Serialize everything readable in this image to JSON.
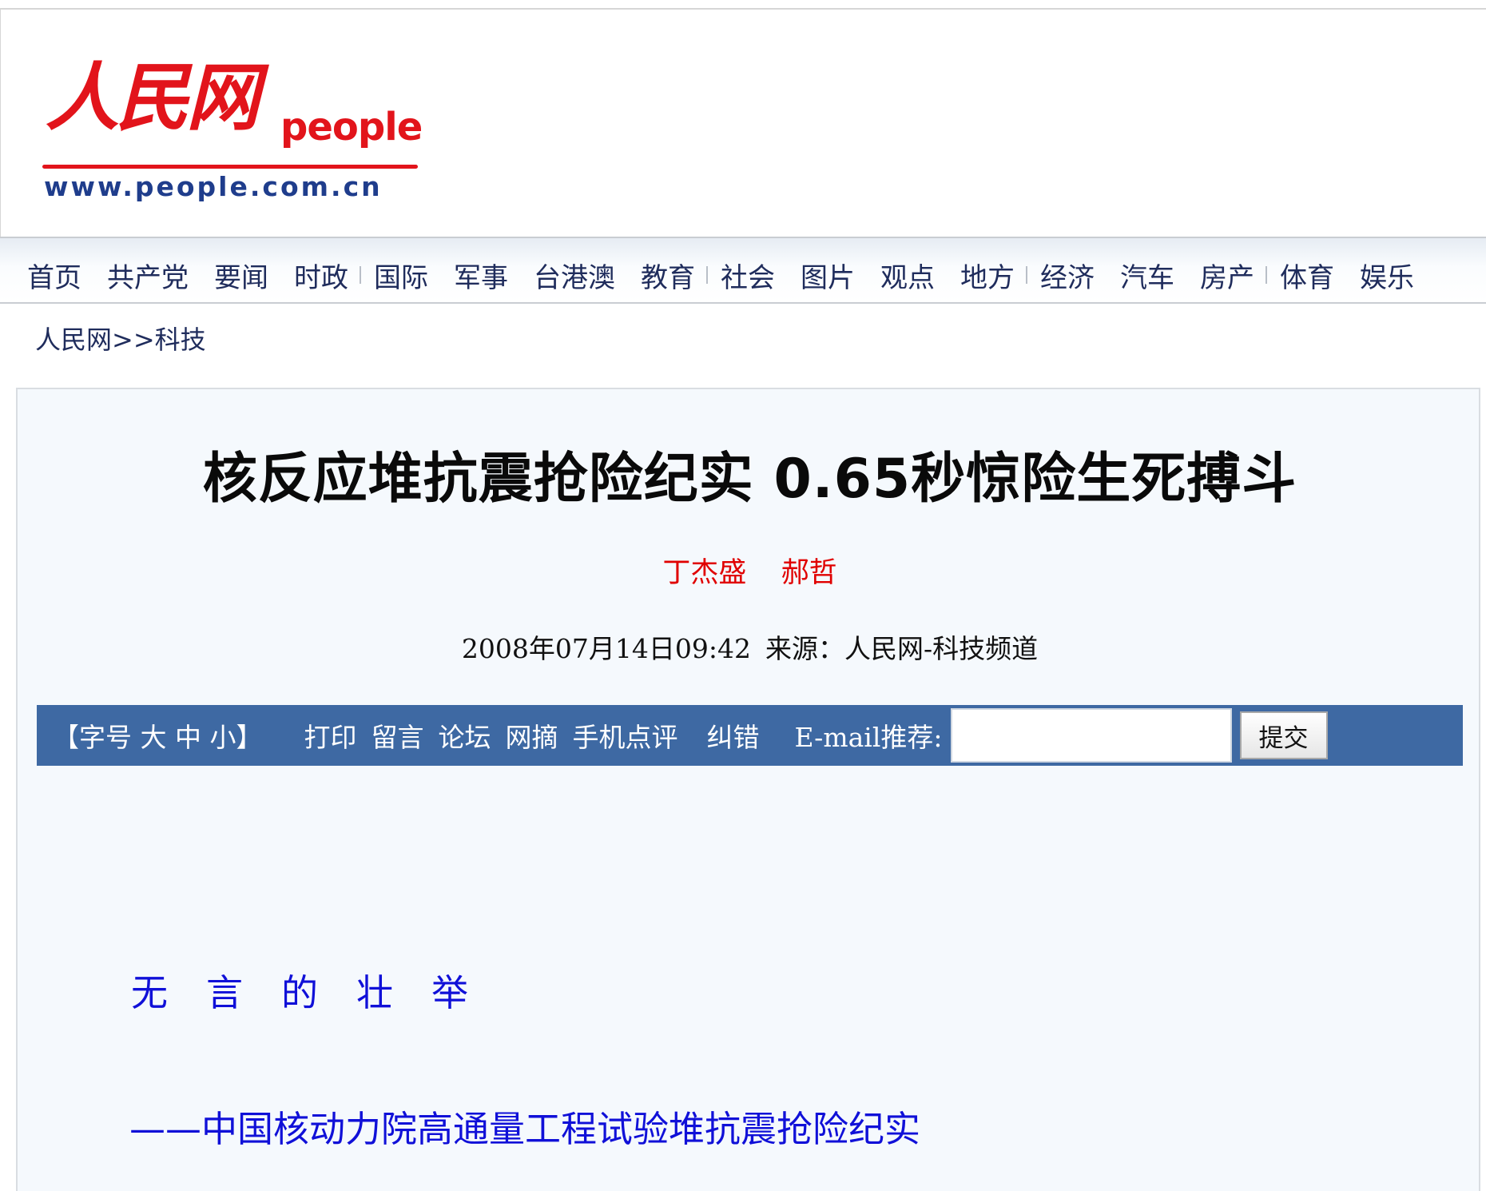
{
  "header": {
    "logo_cn": "人民网",
    "logo_en": "people",
    "logo_url": "www.people.com.cn"
  },
  "nav": {
    "items": [
      {
        "label": "首页",
        "sep_after": false
      },
      {
        "label": "共产党",
        "sep_after": false
      },
      {
        "label": "要闻",
        "sep_after": false
      },
      {
        "label": "时政",
        "sep_after": true
      },
      {
        "label": "国际",
        "sep_after": false
      },
      {
        "label": "军事",
        "sep_after": false
      },
      {
        "label": "台港澳",
        "sep_after": false
      },
      {
        "label": "教育",
        "sep_after": true
      },
      {
        "label": "社会",
        "sep_after": false
      },
      {
        "label": "图片",
        "sep_after": false
      },
      {
        "label": "观点",
        "sep_after": false
      },
      {
        "label": "地方",
        "sep_after": true
      },
      {
        "label": "经济",
        "sep_after": false
      },
      {
        "label": "汽车",
        "sep_after": false
      },
      {
        "label": "房产",
        "sep_after": true
      },
      {
        "label": "体育",
        "sep_after": false
      },
      {
        "label": "娱乐",
        "sep_after": false
      }
    ]
  },
  "breadcrumb": {
    "home": "人民网",
    "separator": ">>",
    "section": "科技"
  },
  "article": {
    "title": "核反应堆抗震抢险纪实 0.65秒惊险生死搏斗",
    "authors": [
      "丁杰盛",
      "郝哲"
    ],
    "date": "2008年07月14日09:42",
    "source": "来源：人民网-科技频道",
    "section_heading": "无言的壮举",
    "subtitle": "——中国核动力院高通量工程试验堆抗震抢险纪实"
  },
  "toolbar": {
    "font_size": "【字号 大 中 小】",
    "print": "打印",
    "comment": "留言",
    "forum": "论坛",
    "digest": "网摘",
    "mobile_review": "手机点评",
    "correction": "纠错",
    "email_label": "E-mail推荐:",
    "email_value": "",
    "submit": "提交"
  },
  "colors": {
    "logo_red": "#e2141b",
    "logo_blue": "#1f3d8c",
    "toolbar_bg": "#3e69a3",
    "author_red": "#e00000",
    "heading_blue": "#1010d8",
    "content_bg": "#f5f9fd"
  }
}
